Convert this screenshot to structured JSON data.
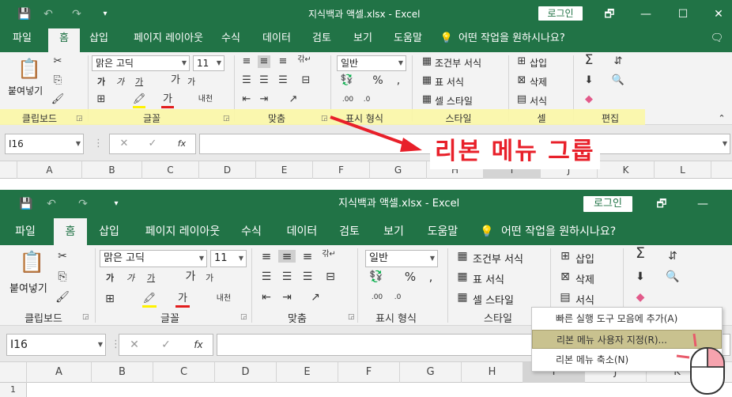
{
  "top": {
    "title": "지식백과 액셀.xlsx  -  Excel",
    "login": "로그인",
    "tabs": [
      "파일",
      "홈",
      "삽입",
      "페이지 레이아웃",
      "수식",
      "데이터",
      "검토",
      "보기",
      "도움말"
    ],
    "tell_me": "어떤 작업을 원하시나요?",
    "font_name": "맑은 고딕",
    "font_size": "11",
    "number_format": "일반",
    "paste_label": "붙여넣기",
    "conditional": "조건부 서식",
    "table_format": "표 서식",
    "cell_style": "셀 스타일",
    "insert": "삽입",
    "delete": "삭제",
    "format": "서식",
    "groups": [
      "클립보드",
      "글꼴",
      "맞춤",
      "표시 형식",
      "스타일",
      "셀",
      "편집"
    ],
    "name_box": "I16",
    "columns": [
      "A",
      "B",
      "C",
      "D",
      "E",
      "F",
      "G",
      "H",
      "I",
      "J",
      "K",
      "L"
    ],
    "annotation": "리본 메뉴 그룹"
  },
  "bottom": {
    "title": "지식백과 액셀.xlsx  -  Excel",
    "login": "로그인",
    "tabs": [
      "파일",
      "홈",
      "삽입",
      "페이지 레이아웃",
      "수식",
      "데이터",
      "검토",
      "보기",
      "도움말"
    ],
    "tell_me": "어떤 작업을 원하시나요?",
    "font_name": "맑은 고딕",
    "font_size": "11",
    "number_format": "일반",
    "paste_label": "붙여넣기",
    "conditional": "조건부 서식",
    "table_format": "표 서식",
    "cell_style": "셀 스타일",
    "insert": "삽입",
    "delete": "삭제",
    "format": "서식",
    "groups": [
      "클립보드",
      "글꼴",
      "맞춤",
      "표시 형식",
      "스타일"
    ],
    "name_box": "I16",
    "columns": [
      "A",
      "B",
      "C",
      "D",
      "E",
      "F",
      "G",
      "H",
      "I",
      "J",
      "K"
    ],
    "row1": "1",
    "context_menu": [
      "빠른 실행 도구 모음에 추가(A)",
      "리본 메뉴 사용자 지정(R)...",
      "리본 메뉴 축소(N)"
    ]
  },
  "glyphs": {
    "save": "💾",
    "undo": "↶",
    "redo": "↷",
    "more": "▾",
    "restore": "🗗",
    "minimize": "—",
    "maximize": "☐",
    "close": "✕",
    "bulb": "💡",
    "comment": "🗨",
    "cut": "✂",
    "copy": "⎘",
    "brush": "🖌",
    "bold": "가",
    "italic": "가",
    "underline": "가",
    "grow": "가",
    "shrink": "가",
    "border": "⊞",
    "fill": "🖍",
    "fontcolor": "가",
    "phonetic": "내천",
    "percent": "%",
    "comma": ",",
    "sum": "Σ",
    "sort": "⇵",
    "find": "🔍",
    "clear": "◆",
    "cancel": "✕",
    "ok": "✓",
    "fx": "fx",
    "expand": "⌃"
  },
  "colors": {
    "excel_green": "#217346",
    "annotation_red": "#e8202a",
    "highlight_yellow": "#fbf7a6"
  }
}
